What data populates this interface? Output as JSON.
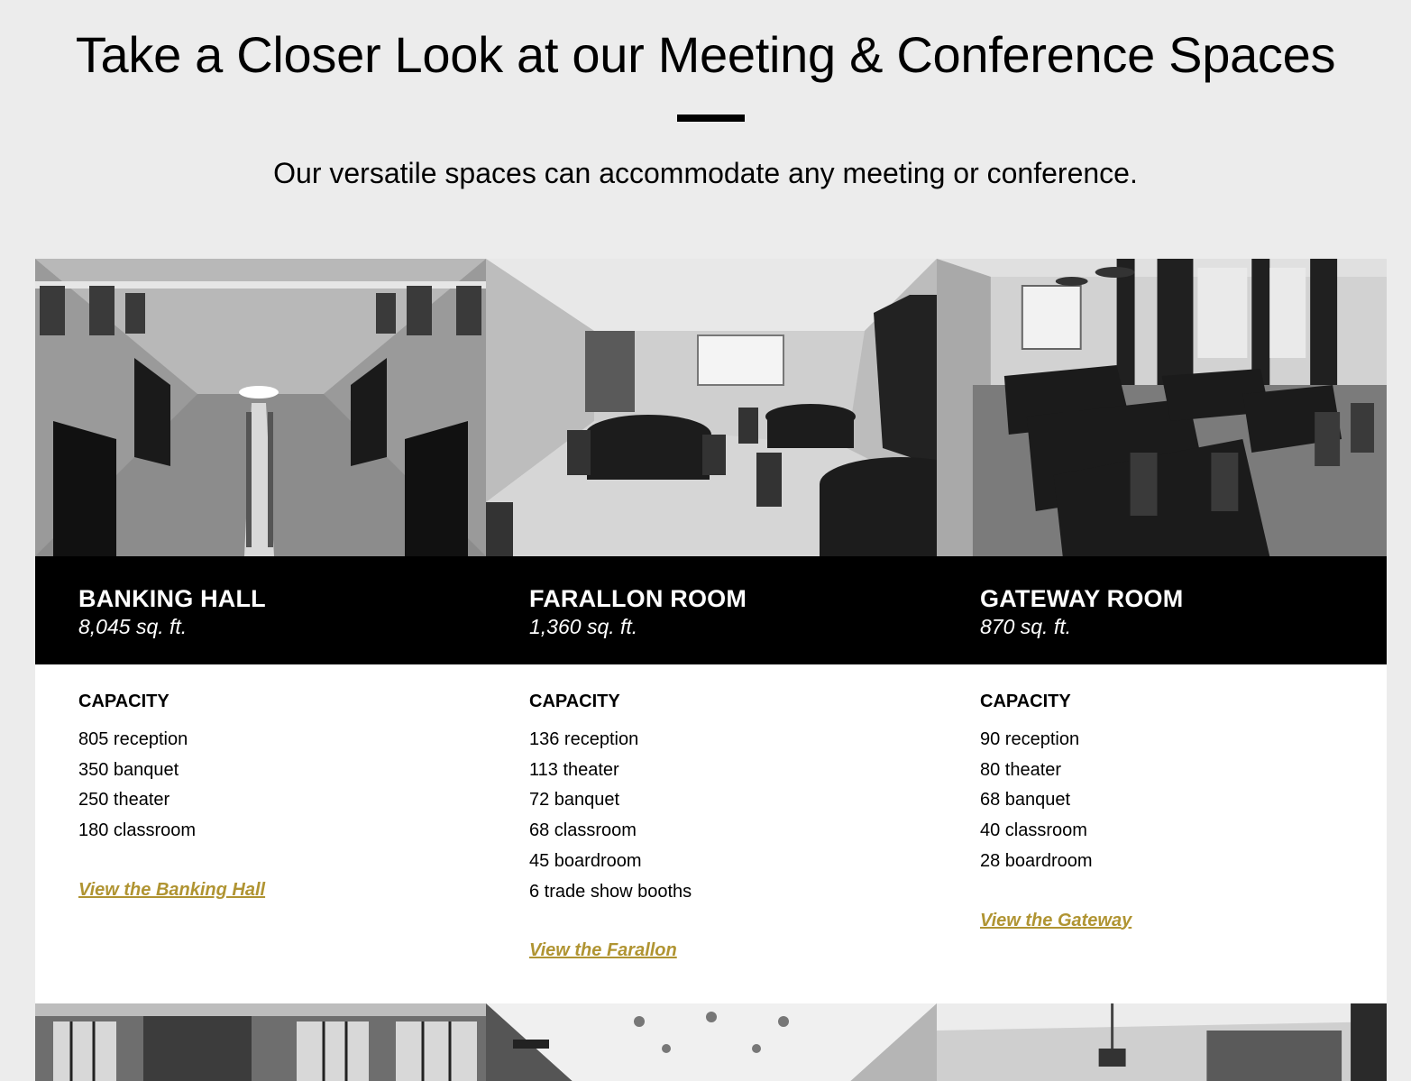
{
  "header": {
    "title": "Take a Closer Look at our Meeting & Conference Spaces",
    "subtitle": "Our versatile spaces can accommodate any meeting or conference."
  },
  "rooms": [
    {
      "name": "BANKING HALL",
      "size": "8,045 sq. ft.",
      "capacity_heading": "CAPACITY",
      "capacity": [
        "805 reception",
        "350 banquet",
        "250 theater",
        "180 classroom"
      ],
      "link": "View the Banking Hall"
    },
    {
      "name": "FARALLON ROOM",
      "size": "1,360 sq. ft.",
      "capacity_heading": "CAPACITY",
      "capacity": [
        "136 reception",
        "113 theater",
        "72 banquet",
        "68 classroom",
        "45 boardroom",
        "6 trade show booths"
      ],
      "link": "View the Farallon"
    },
    {
      "name": "GATEWAY ROOM",
      "size": "870 sq. ft.",
      "capacity_heading": "CAPACITY",
      "capacity": [
        "90 reception",
        "80 theater",
        "68 banquet",
        "40 classroom",
        "28 boardroom"
      ],
      "link": "View the Gateway"
    }
  ],
  "colors": {
    "background": "#ececec",
    "link": "#b09432",
    "namebar": "#000000"
  }
}
